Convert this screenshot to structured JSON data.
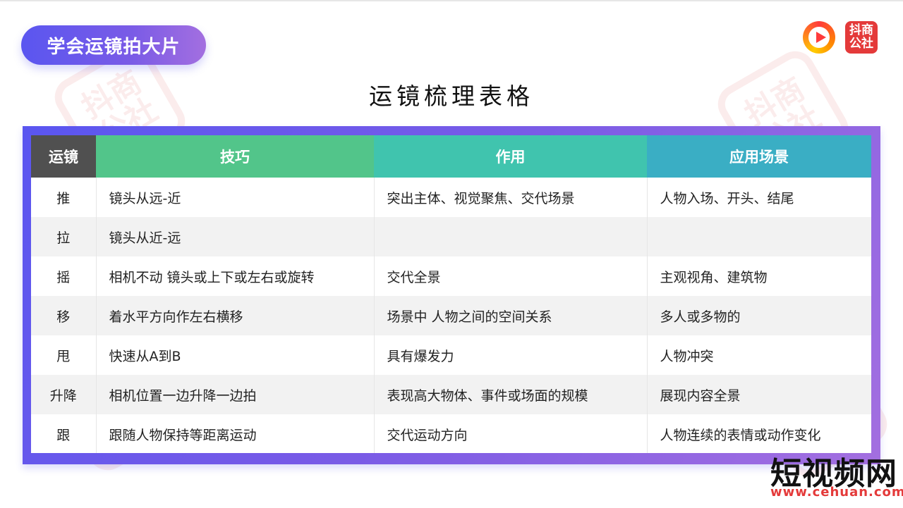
{
  "header": {
    "badge_title": "学会运镜拍大片",
    "page_title": "运镜梳理表格",
    "logo_badge_text": "抖商公社",
    "logo_play_icon": "play-circle-icon"
  },
  "table": {
    "headers": [
      "运镜",
      "技巧",
      "作用",
      "应用场景"
    ],
    "rows": [
      {
        "move": "推",
        "technique": "镜头从远-近",
        "effect": "突出主体、视觉聚焦、交代场景",
        "scene": "人物入场、开头、结尾"
      },
      {
        "move": "拉",
        "technique": "镜头从近-远",
        "effect": "",
        "scene": ""
      },
      {
        "move": "摇",
        "technique": "相机不动 镜头或上下或左右或旋转",
        "effect": "交代全景",
        "scene": "主观视角、建筑物"
      },
      {
        "move": "移",
        "technique": "着水平方向作左右横移",
        "effect": "场景中 人物之间的空间关系",
        "scene": "多人或多物的"
      },
      {
        "move": "甩",
        "technique": "快速从A到B",
        "effect": "具有爆发力",
        "scene": "人物冲突"
      },
      {
        "move": "升降",
        "technique": "相机位置一边升降一边拍",
        "effect": "表现高大物体、事件或场面的规模",
        "scene": "展现内容全景"
      },
      {
        "move": "跟",
        "technique": "跟随人物保持等距离运动",
        "effect": "交代运动方向",
        "scene": "人物连续的表情或动作变化"
      }
    ]
  },
  "footer": {
    "brand": "短视频网",
    "url": "www.cehuan.com"
  },
  "colors": {
    "accent_start": "#5a56f0",
    "accent_end": "#a36fe0",
    "header_move": "#505050",
    "header_technique": "#52c58a",
    "header_effect": "#40c4ae",
    "header_scene": "#3aaec4",
    "brand_red": "#e43a3a"
  }
}
